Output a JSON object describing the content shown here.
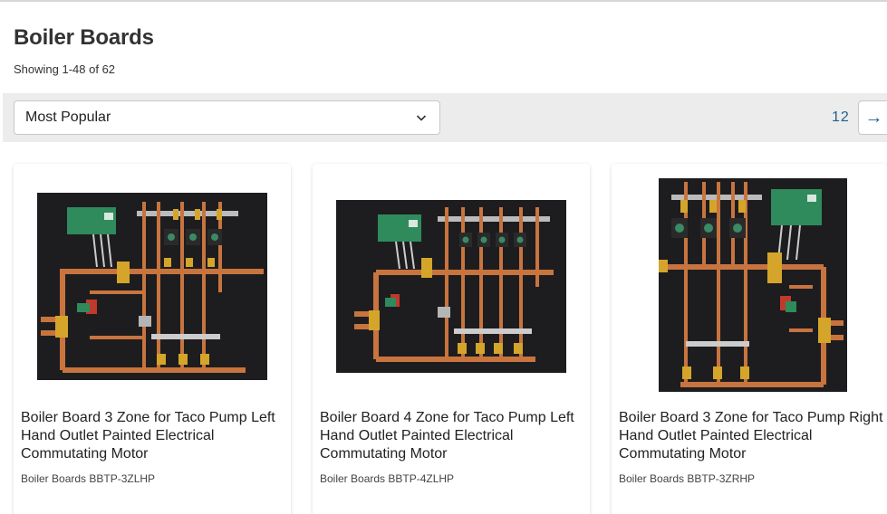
{
  "page": {
    "title": "Boiler Boards",
    "result_count": "Showing 1-48 of 62"
  },
  "toolbar": {
    "sort_value": "Most Popular",
    "pages": [
      "1",
      "2"
    ],
    "next_label": "→"
  },
  "products": [
    {
      "title": "Boiler Board 3 Zone for Taco Pump Left Hand Outlet Painted Electrical Commutating Motor",
      "sku": "Boiler Boards BBTP-3ZLHP"
    },
    {
      "title": "Boiler Board 4 Zone for Taco Pump Left Hand Outlet Painted Electrical Commutating Motor",
      "sku": "Boiler Boards BBTP-4ZLHP"
    },
    {
      "title": "Boiler Board 3 Zone for Taco Pump Right Hand Outlet Painted Electrical Commutating Motor",
      "sku": "Boiler Boards BBTP-3ZRHP"
    }
  ],
  "colors": {
    "accent": "#1f5f8b",
    "toolbar_bg": "#ececec",
    "copper": "#c8743f",
    "brass": "#d4a52a",
    "control_green": "#2f8a5c",
    "board_black": "#1d1d1f"
  },
  "icons": {
    "sort_toggle": "chevron-down-icon",
    "next_page": "arrow-right-icon"
  }
}
